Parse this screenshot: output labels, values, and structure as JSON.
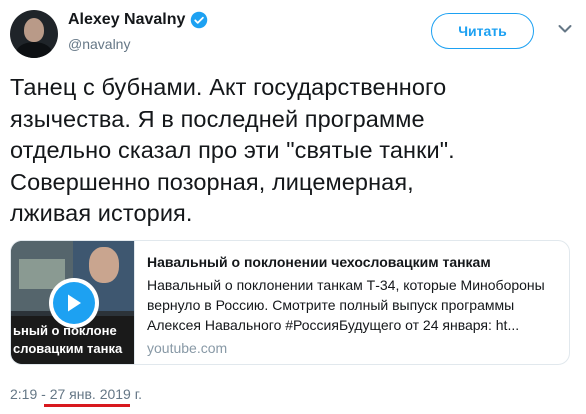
{
  "author": {
    "name": "Alexey Navalny",
    "handle": "@navalny",
    "verified": true,
    "avatar_icon": "avatar-photo"
  },
  "follow_button": {
    "label": "Читать",
    "color": "#1da1f2"
  },
  "menu_icon": "chevron-down-icon",
  "tweet": {
    "lines": [
      "Танец с бубнами. Акт государственного",
      "язычества. Я в последней программе",
      "отдельно сказал про эти \"святые танки\".",
      "Совершенно позорная, лицемерная,",
      "лживая история."
    ]
  },
  "card": {
    "thumb_caption_lines": [
      "ьный о поклоне",
      "словацким танка"
    ],
    "title": "Навальный о поклонении чехословацким танкам",
    "description_lines": [
      "Навальный о поклонении танкам Т-34, которые Минобороны",
      "вернуло в Россию. Смотрите полный выпуск программы",
      "Алексея Навального #РоссияБудущего от 24 января: ht..."
    ],
    "domain": "youtube.com",
    "play_icon": "play-icon"
  },
  "meta": {
    "time": "2:19",
    "separator": "-",
    "date": "27 янв. 2019 г.",
    "underline_color": "#d8181e"
  }
}
